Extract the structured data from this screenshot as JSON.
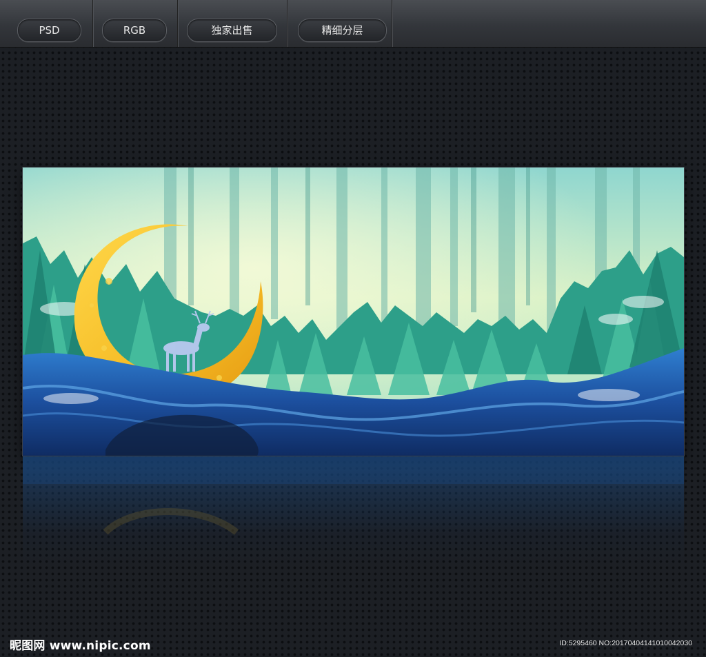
{
  "toolbar": {
    "tabs": [
      {
        "label": "PSD"
      },
      {
        "label": "RGB"
      },
      {
        "label": "独家出售"
      },
      {
        "label": "精细分层"
      }
    ]
  },
  "footer": {
    "watermark": "昵图网 www.nipic.com",
    "id_text": "ID:5295460 NO:20170404141010042030"
  },
  "colors": {
    "background": "#1c1f24",
    "moon": "#f6c22f",
    "water": "#1e56a8",
    "forest": "#2fa58e"
  }
}
